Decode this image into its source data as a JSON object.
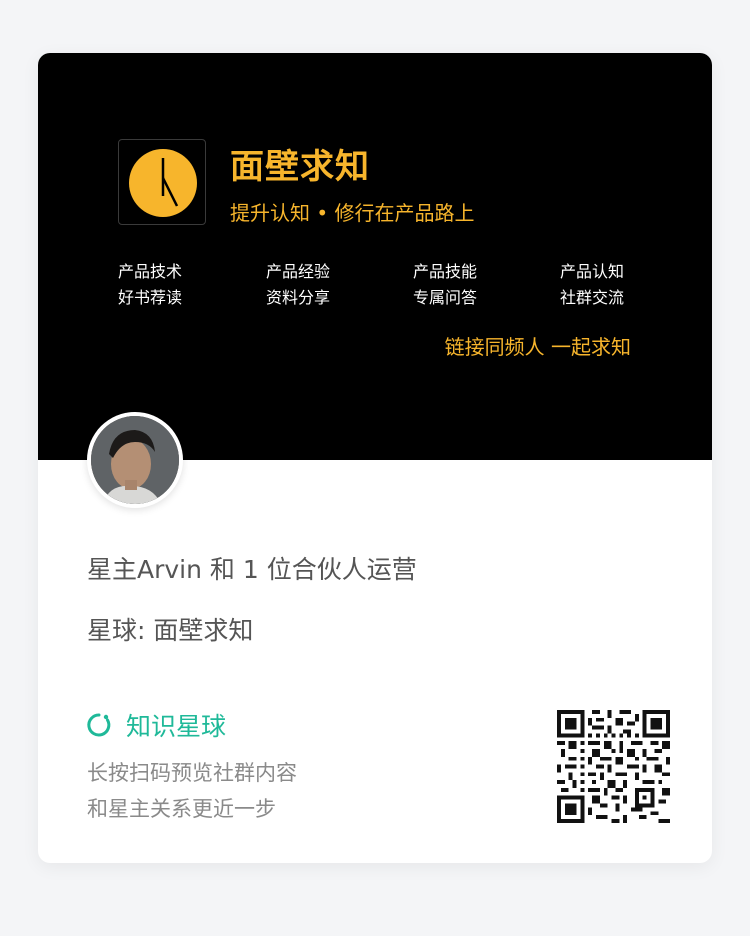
{
  "banner": {
    "brand_title": "面壁求知",
    "brand_tagline": "提升认知 • 修行在产品路上",
    "features": [
      {
        "line1": "产品技术",
        "line2": "好书荐读"
      },
      {
        "line1": "产品经验",
        "line2": "资料分享"
      },
      {
        "line1": "产品技能",
        "line2": "专属问答"
      },
      {
        "line1": "产品认知",
        "line2": "社群交流"
      }
    ],
    "slogan": "链接同频人 一起求知",
    "accent_color": "#f7b52c",
    "background_color": "#000000"
  },
  "profile": {
    "avatar_icon": "owner-avatar",
    "owner_line": "星主Arvin 和 1 位合伙人运营",
    "planet_line": "星球: 面壁求知"
  },
  "footer": {
    "app_icon": "zsxq-logo-icon",
    "app_name": "知识星球",
    "app_color": "#1fb999",
    "hint_line1": "长按扫码预览社群内容",
    "hint_line2": "和星主关系更近一步",
    "qr_icon": "qr-code"
  }
}
